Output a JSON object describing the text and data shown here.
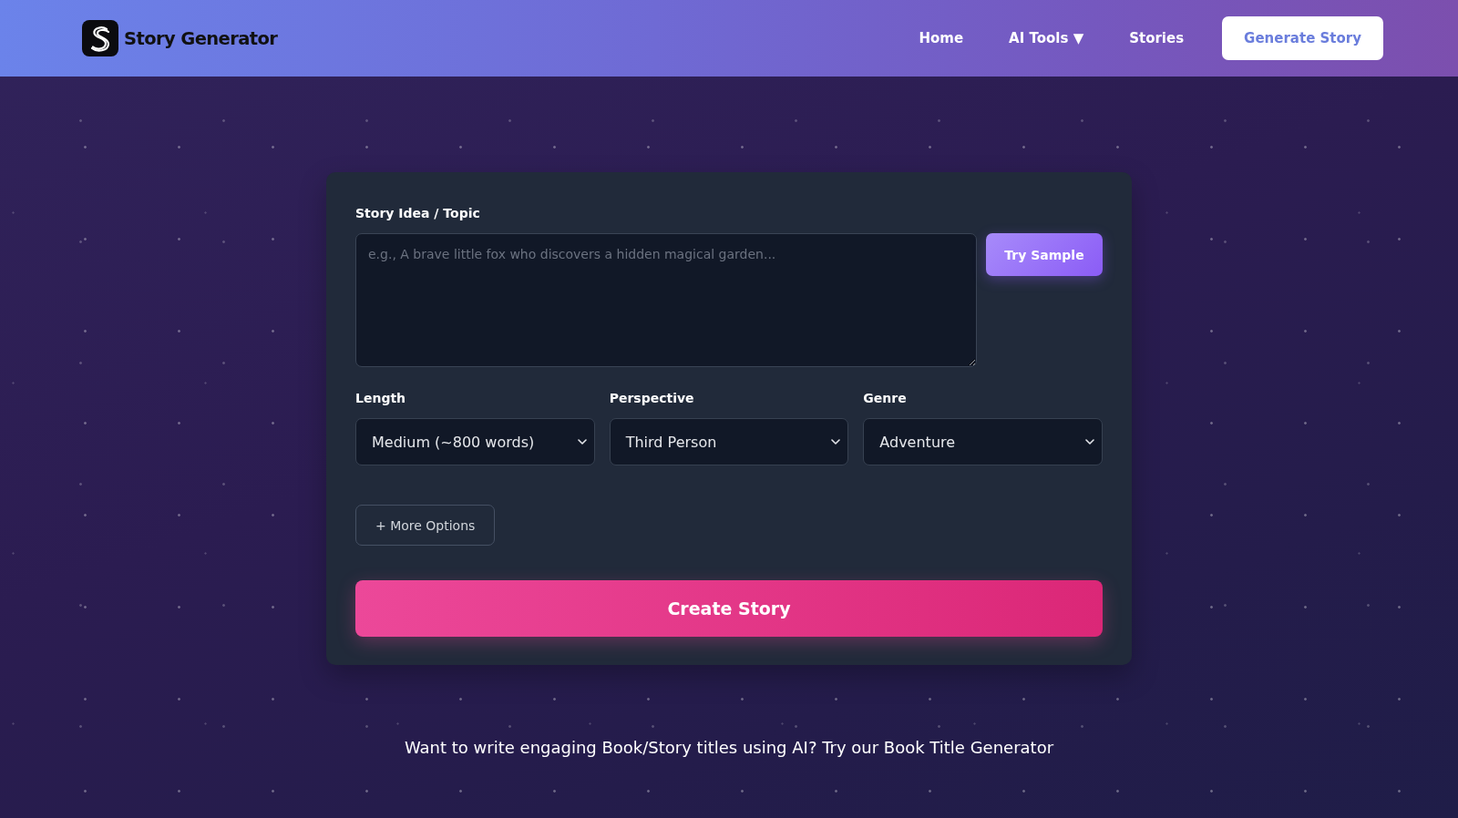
{
  "header": {
    "brand": "Story Generator",
    "nav": [
      {
        "label": "Home"
      },
      {
        "label": "AI Tools ▼"
      },
      {
        "label": "Stories"
      }
    ],
    "cta": "Generate Story"
  },
  "form": {
    "idea": {
      "label": "Story Idea / Topic",
      "placeholder": "e.g., A brave little fox who discovers a hidden magical garden...",
      "sample_button": "Try Sample"
    },
    "selects": [
      {
        "label": "Length",
        "value": "Medium (~800 words)"
      },
      {
        "label": "Perspective",
        "value": "Third Person"
      },
      {
        "label": "Genre",
        "value": "Adventure"
      }
    ],
    "more_options": "+ More Options",
    "submit": "Create Story"
  },
  "footer_text": "Want to write engaging Book/Story titles using AI? Try our Book Title Generator"
}
